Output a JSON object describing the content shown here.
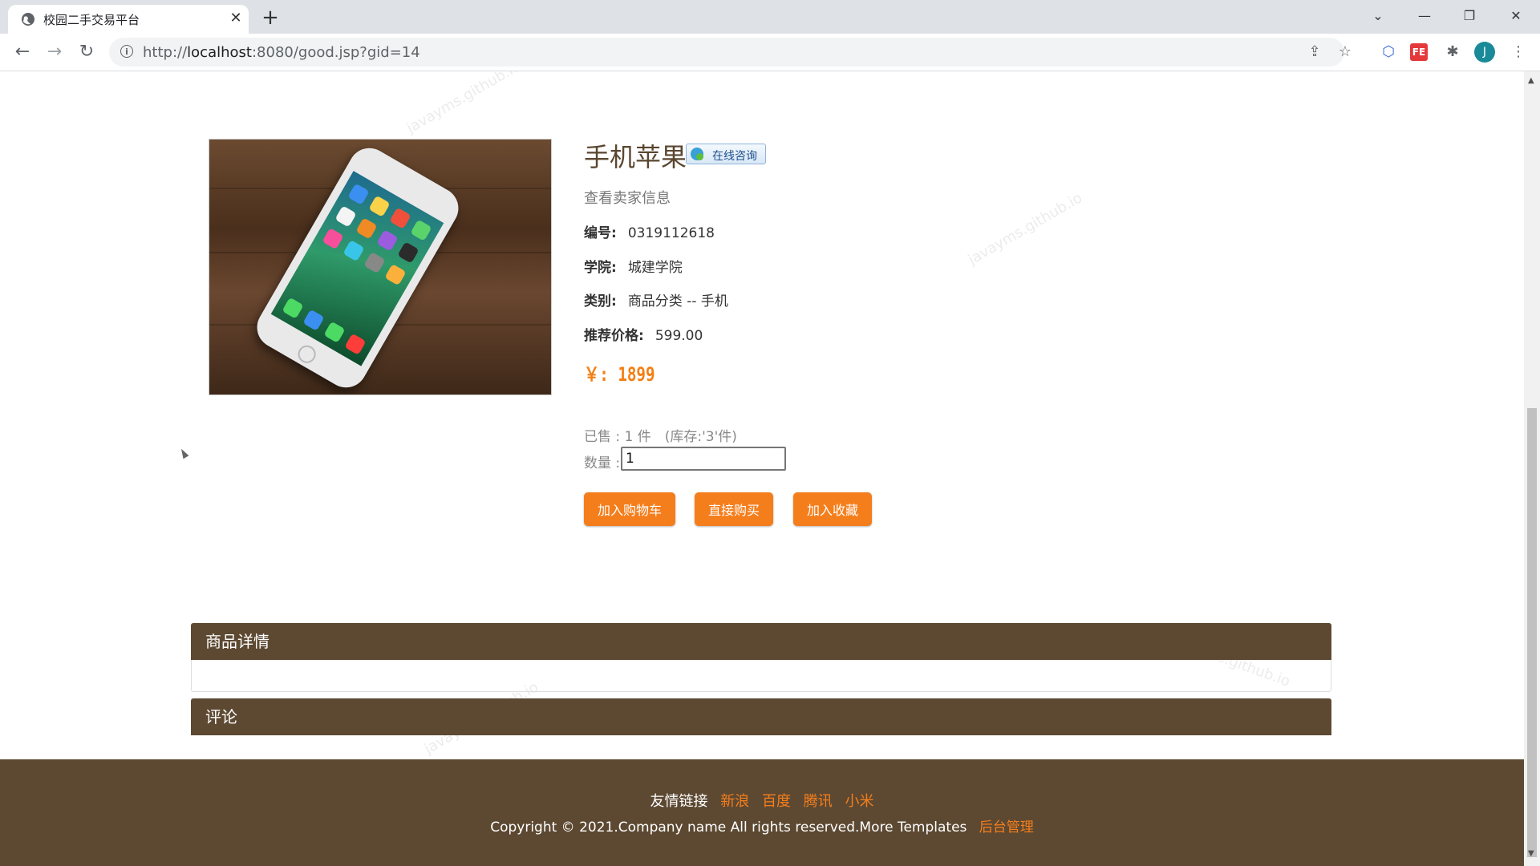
{
  "browser": {
    "tab_title": "校园二手交易平台",
    "url_prefix": "http://",
    "url_host": "localhost",
    "url_rest": ":8080/good.jsp?gid=14",
    "avatar_letter": "J"
  },
  "watermark": "javayms.github.io",
  "product": {
    "name": "手机苹果",
    "consult_label": "在线咨询",
    "seller_link": "查看卖家信息",
    "info": [
      {
        "label": "编号:",
        "value": "0319112618"
      },
      {
        "label": "学院:",
        "value": "城建学院"
      },
      {
        "label": "类别:",
        "value": "商品分类 -- 手机"
      },
      {
        "label": "推荐价格:",
        "value": "599.00"
      }
    ],
    "price": "￥: 1899",
    "sold": "已售 : 1 件　(库存:'3'件)",
    "qty_label": "数量 :",
    "qty_value": "1"
  },
  "buttons": {
    "add_cart": "加入购物车",
    "buy_now": "直接购买",
    "favorite": "加入收藏"
  },
  "sections": {
    "details": "商品详情",
    "comments": "评论"
  },
  "footer": {
    "links_label": "友情链接",
    "links": [
      "新浪",
      "百度",
      "腾讯",
      "小米"
    ],
    "copyright": "Copyright © 2021.Company name All rights reserved.More Templates",
    "admin_link": "后台管理"
  },
  "colors": {
    "accent": "#f57e1c",
    "brown": "#5d4932"
  }
}
